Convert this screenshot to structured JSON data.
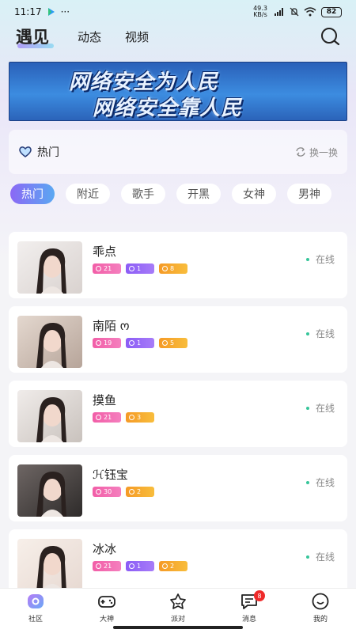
{
  "status_bar": {
    "time": "11:17",
    "dots": "···",
    "net_speed": "49.3 KB/s",
    "battery": "82"
  },
  "top_nav": {
    "tabs": [
      "遇见",
      "动态",
      "视频"
    ],
    "active_tab": "遇见",
    "search_icon": "search-icon"
  },
  "banner": {
    "line1": "网络安全为人民",
    "line2": "网络安全靠人民"
  },
  "hot": {
    "title": "热门",
    "refresh_label": "换一换",
    "icon": "heart-icon"
  },
  "chips": [
    "热门",
    "附近",
    "歌手",
    "开黑",
    "女神",
    "男神"
  ],
  "users": [
    {
      "name": "乖点",
      "status": "在线",
      "badges": [
        {
          "type": "pink",
          "value": "21"
        },
        {
          "type": "purple",
          "value": "1"
        },
        {
          "type": "orange",
          "value": "8"
        }
      ]
    },
    {
      "name": "南陌 ო",
      "status": "在线",
      "badges": [
        {
          "type": "pink",
          "value": "19"
        },
        {
          "type": "purple",
          "value": "1"
        },
        {
          "type": "orange",
          "value": "5"
        }
      ]
    },
    {
      "name": "摸鱼",
      "status": "在线",
      "badges": [
        {
          "type": "pink",
          "value": "21"
        },
        {
          "type": "orange",
          "value": "3"
        }
      ]
    },
    {
      "name": "ℋ钰宝",
      "status": "在线",
      "badges": [
        {
          "type": "pink",
          "value": "30"
        },
        {
          "type": "orange",
          "value": "2"
        }
      ]
    },
    {
      "name": "冰冰",
      "status": "在线",
      "badges": [
        {
          "type": "pink",
          "value": "21"
        },
        {
          "type": "purple",
          "value": "1"
        },
        {
          "type": "orange",
          "value": "2"
        }
      ]
    }
  ],
  "bottom_nav": {
    "items": [
      {
        "label": "社区",
        "icon": "community-icon"
      },
      {
        "label": "大神",
        "icon": "gamepad-icon"
      },
      {
        "label": "派对",
        "icon": "party-icon"
      },
      {
        "label": "消息",
        "icon": "message-icon",
        "badge": "8"
      },
      {
        "label": "我的",
        "icon": "profile-icon"
      }
    ]
  },
  "colors": {
    "accent_purple": "#8b68f5",
    "accent_blue": "#5aa8f2",
    "online_green": "#36c59a",
    "badge_red": "#ef2b2b"
  }
}
